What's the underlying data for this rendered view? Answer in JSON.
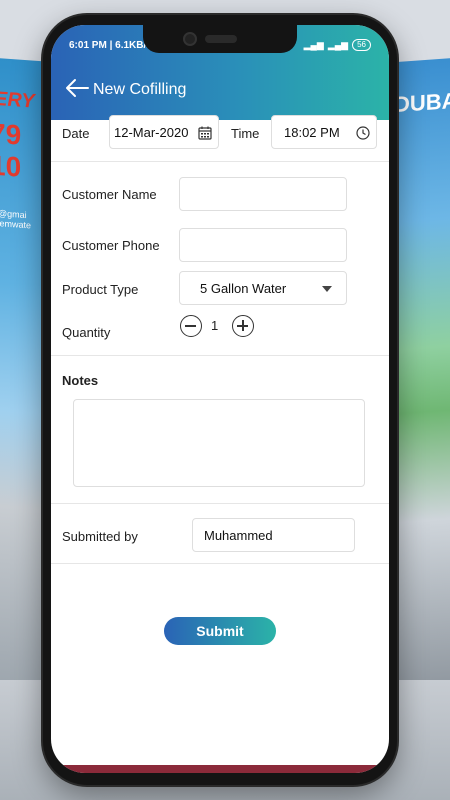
{
  "status_bar": {
    "time": "6:01 PM | 6.1KB/s",
    "battery": "56"
  },
  "header": {
    "title": "New Cofilling"
  },
  "background": {
    "left_poster_text": "ERY",
    "left_poster_number": "79 10",
    "left_poster_email": "er@gmai seemwate",
    "right_poster_text": "DUBA"
  },
  "form": {
    "date_label": "Date",
    "date_value": "12-Mar-2020",
    "time_label": "Time",
    "time_value": "18:02 PM",
    "customer_name_label": "Customer Name",
    "customer_name_value": "",
    "customer_phone_label": "Customer Phone",
    "customer_phone_value": "",
    "product_type_label": "Product Type",
    "product_type_value": "5 Gallon Water",
    "quantity_label": "Quantity",
    "quantity_value": "1",
    "notes_label": "Notes",
    "notes_value": "",
    "submitted_by_label": "Submitted by",
    "submitted_by_value": "Muhammed",
    "submit_label": "Submit"
  },
  "colors": {
    "header_start": "#2a63b6",
    "header_end": "#2bb3a8"
  },
  "icons": [
    "back-arrow-icon",
    "calendar-icon",
    "clock-icon",
    "dropdown-caret-icon",
    "minus-icon",
    "plus-icon"
  ]
}
